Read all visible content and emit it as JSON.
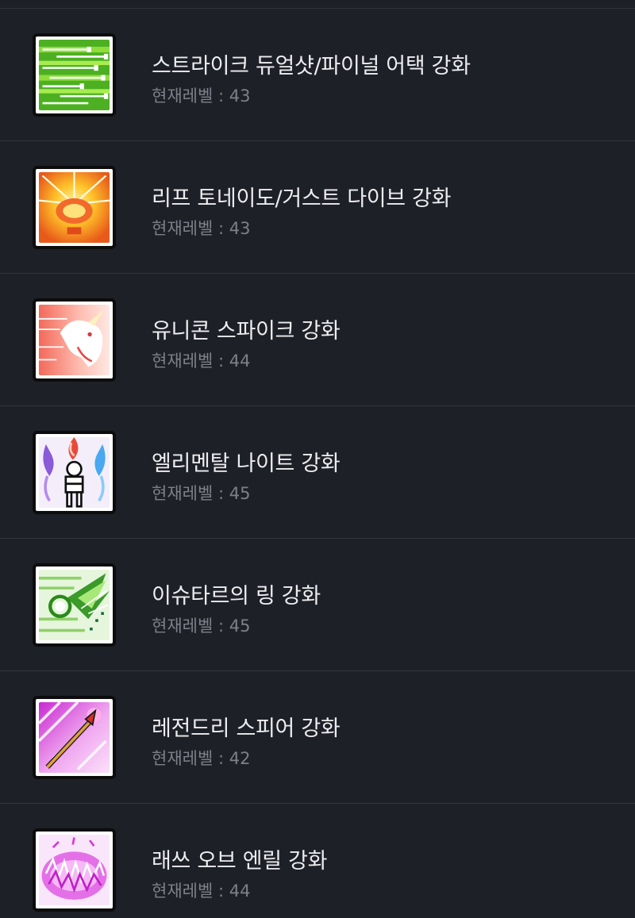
{
  "skills": [
    {
      "title": "스트라이크 듀얼샷/파이널 어택 강화",
      "level": "현재레벨 : 43",
      "icon": "arrow-volley-icon",
      "colors": [
        "#3fa81a",
        "#8fdc3a",
        "#e9ffe0"
      ]
    },
    {
      "title": "리프 토네이도/거스트 다이브 강화",
      "level": "현재레벨 : 43",
      "icon": "leaf-tornado-icon",
      "colors": [
        "#e8501a",
        "#ffd23a",
        "#fff6b0"
      ]
    },
    {
      "title": "유니콘 스파이크 강화",
      "level": "현재레벨 : 44",
      "icon": "unicorn-icon",
      "colors": [
        "#f27a6a",
        "#ffd0c8",
        "#ffffff"
      ]
    },
    {
      "title": "엘리멘탈 나이트 강화",
      "level": "현재레벨 : 45",
      "icon": "elemental-knight-icon",
      "colors": [
        "#8a5ad8",
        "#e84a3a",
        "#4aa8f0"
      ]
    },
    {
      "title": "이슈타르의 링 강화",
      "level": "현재레벨 : 45",
      "icon": "ring-icon",
      "colors": [
        "#4aa83a",
        "#bfe8a0",
        "#ffffff"
      ]
    },
    {
      "title": "레전드리 스피어 강화",
      "level": "현재레벨 : 42",
      "icon": "spear-icon",
      "colors": [
        "#d43ad8",
        "#f7b0f0",
        "#ffffff"
      ]
    },
    {
      "title": "래쓰 오브 엔릴 강화",
      "level": "현재레벨 : 44",
      "icon": "wrath-of-enlil-icon",
      "colors": [
        "#d43ad8",
        "#f7c0f0",
        "#ffffff"
      ]
    }
  ]
}
